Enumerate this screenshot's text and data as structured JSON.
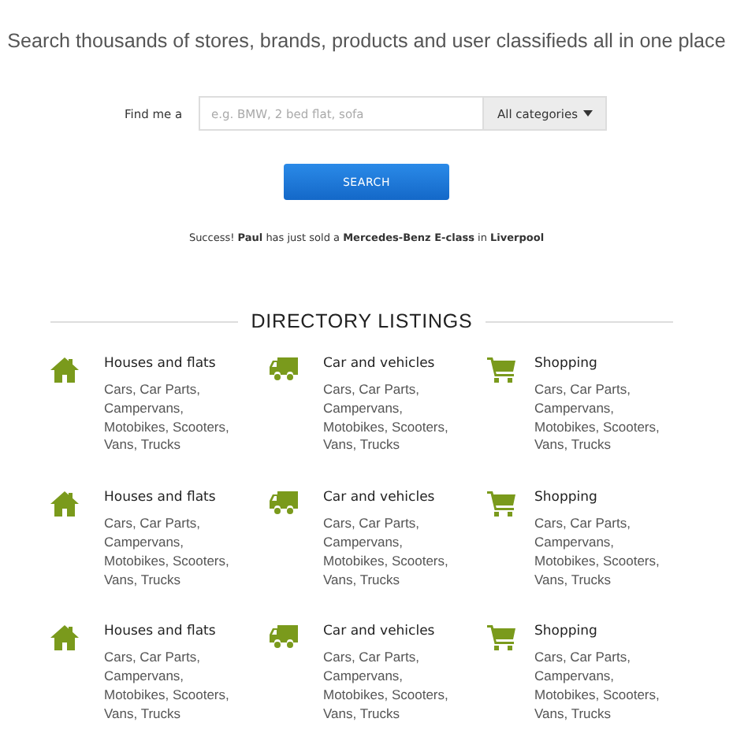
{
  "tagline": "Search thousands of stores, brands, products and user classifieds all in one place",
  "search": {
    "label": "Find me a",
    "placeholder": "e.g. BMW, 2 bed flat, sofa",
    "category": "All categories",
    "button": "SEARCH"
  },
  "notice": "Success! **Paul** has just sold a **Mercedes-Benz E-class** in **Liverpool**",
  "directory": {
    "heading": "DIRECTORY LISTINGS",
    "listings": [
      {
        "kind": "house",
        "title": "Houses and flats",
        "description": "Cars, Car Parts, Campervans, Motobikes, Scooters, Vans, Trucks"
      },
      {
        "kind": "truck",
        "title": "Car and vehicles",
        "description": "Cars, Car Parts, Campervans, Motobikes, Scooters, Vans, Trucks"
      },
      {
        "kind": "cart",
        "title": "Shopping",
        "description": "Cars, Car Parts, Campervans, Motobikes, Scooters, Vans, Trucks"
      },
      {
        "kind": "house",
        "title": "Houses and flats",
        "description": "Cars, Car Parts, Campervans, Motobikes, Scooters, Vans, Trucks"
      },
      {
        "kind": "truck",
        "title": "Car and vehicles",
        "description": "Cars, Car Parts, Campervans, Motobikes, Scooters, Vans, Trucks"
      },
      {
        "kind": "cart",
        "title": "Shopping",
        "description": "Cars, Car Parts, Campervans, Motobikes, Scooters, Vans, Trucks"
      },
      {
        "kind": "house",
        "title": "Houses and flats",
        "description": "Cars, Car Parts, Campervans, Motobikes, Scooters, Vans, Trucks"
      },
      {
        "kind": "truck",
        "title": "Car and vehicles",
        "description": "Cars, Car Parts, Campervans, Motobikes, Scooters, Vans, Trucks"
      },
      {
        "kind": "cart",
        "title": "Shopping",
        "description": "Cars, Car Parts, Campervans, Motobikes, Scooters, Vans, Trucks"
      }
    ]
  }
}
